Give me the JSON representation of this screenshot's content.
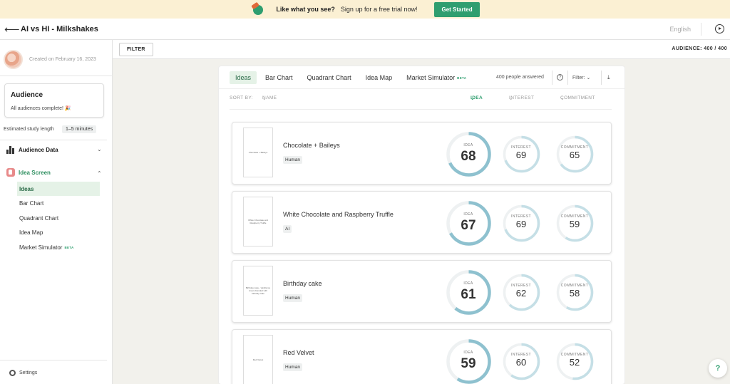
{
  "banner": {
    "bold": "Like what you see?",
    "text": "Sign up for a free trial now!",
    "cta": "Get Started"
  },
  "header": {
    "title": "AI vs HI - Milkshakes",
    "language": "English"
  },
  "filterbar": {
    "filter_label": "FILTER",
    "audience_count": "AUDIENCE: 400 / 400"
  },
  "sidebar": {
    "created": "Created on February 16, 2023",
    "audience_title": "Audience",
    "audience_status": "All audiences complete! 🎉",
    "est_label": "Estimated study length",
    "est_value": "1–5 minutes",
    "sections": [
      {
        "label": "Audience Data",
        "chevron": "⌄"
      },
      {
        "label": "Idea Screen",
        "chevron": "⌃"
      }
    ],
    "items": [
      {
        "label": "Ideas"
      },
      {
        "label": "Bar Chart"
      },
      {
        "label": "Quadrant Chart"
      },
      {
        "label": "Idea Map"
      },
      {
        "label": "Market Simulator",
        "badge": "BETA"
      }
    ],
    "settings": "Settings"
  },
  "panel": {
    "tabs": [
      {
        "label": "Ideas"
      },
      {
        "label": "Bar Chart"
      },
      {
        "label": "Quadrant Chart"
      },
      {
        "label": "Idea Map"
      },
      {
        "label": "Market Simulator",
        "badge": "BETA"
      }
    ],
    "answered": "400 people answered",
    "help": "?",
    "filter": "Filter:",
    "sort_by": "SORT BY:",
    "columns": [
      {
        "label": "NAME"
      },
      {
        "label": "IDEA"
      },
      {
        "label": "INTEREST"
      },
      {
        "label": "COMMITMENT"
      }
    ],
    "metric_labels": {
      "idea": "IDEA",
      "interest": "INTEREST",
      "commitment": "COMMITMENT"
    },
    "ideas": [
      {
        "name": "Chocolate + Baileys",
        "tag": "Human",
        "thumb": "Chocolate + Baileys",
        "idea": 68,
        "interest": 69,
        "commitment": 65
      },
      {
        "name": "White Chocolate and Raspberry Truffle",
        "tag": "AI",
        "thumb": "White Chocolate and Raspberry Truffle",
        "idea": 67,
        "interest": 69,
        "commitment": 59
      },
      {
        "name": "Birthday cake",
        "tag": "Human",
        "thumb": "Birthday cake - Vanilla ice cream blended with birthday cake",
        "idea": 61,
        "interest": 62,
        "commitment": 58
      },
      {
        "name": "Red Velvet",
        "tag": "Human",
        "thumb": "Red Velvet",
        "idea": 59,
        "interest": 60,
        "commitment": 52
      }
    ]
  },
  "colors": {
    "accent": "#2f9e6f",
    "gauge_dark": "#8ec1cf",
    "gauge_light": "#c5dfe6",
    "gauge_track": "#eef1f2"
  },
  "help_fab": "?"
}
